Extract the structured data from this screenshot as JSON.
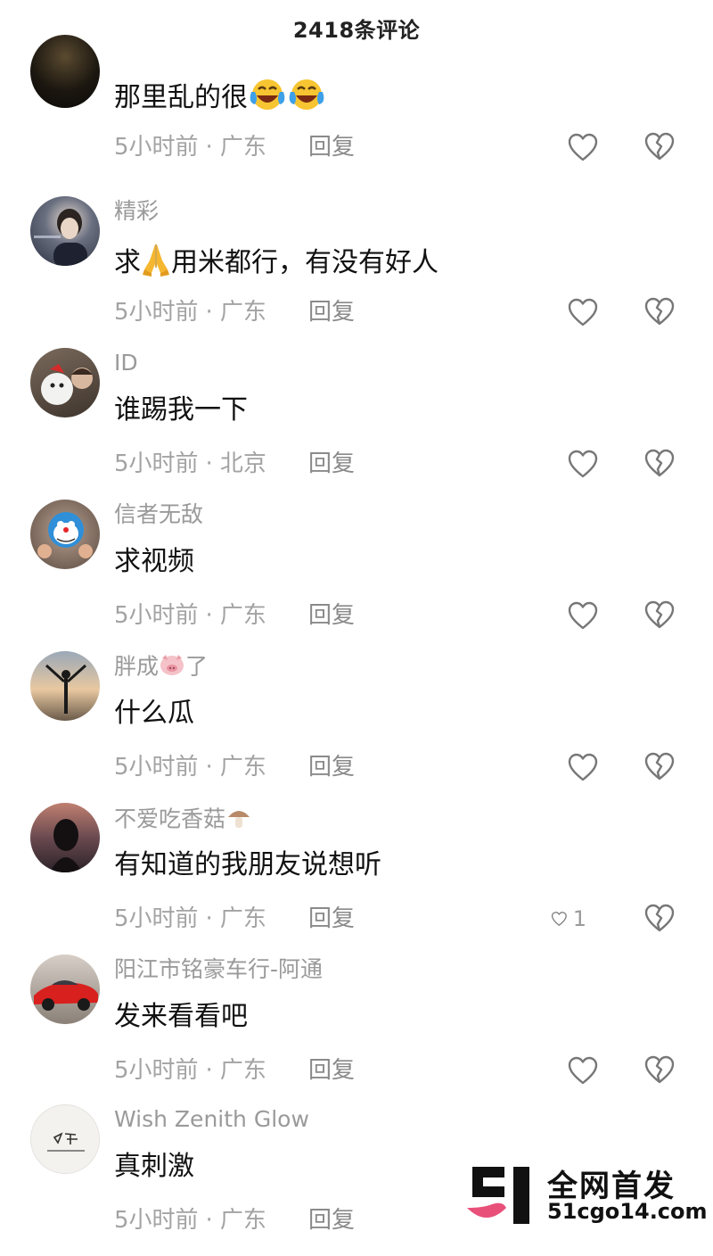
{
  "header": {
    "title": "2418条评论"
  },
  "comments": [
    {
      "username": "",
      "text": "那里乱的很",
      "emoji": "laughing-crying-emoji",
      "time": "5小时前",
      "location": "广东",
      "reply": "回复",
      "likes": ""
    },
    {
      "username": "精彩",
      "text_before": "求",
      "emoji": "praying-hands-emoji",
      "text_after": "用米都行，有没有好人",
      "time": "5小时前",
      "location": "广东",
      "reply": "回复",
      "likes": ""
    },
    {
      "username": "ID",
      "text": "谁踢我一下",
      "time": "5小时前",
      "location": "北京",
      "reply": "回复",
      "likes": ""
    },
    {
      "username": "信者无敌",
      "text": "求视频",
      "time": "5小时前",
      "location": "广东",
      "reply": "回复",
      "likes": ""
    },
    {
      "username_before": "胖成",
      "username_emoji": "pig-face-emoji",
      "username_after": "了",
      "text": "什么瓜",
      "time": "5小时前",
      "location": "广东",
      "reply": "回复",
      "likes": ""
    },
    {
      "username": "不爱吃香菇",
      "username_emoji": "mushroom-emoji",
      "text": "有知道的我朋友说想听",
      "time": "5小时前",
      "location": "广东",
      "reply": "回复",
      "likes": "1"
    },
    {
      "username": "阳江市铭豪车行-阿通",
      "text": "发来看看吧",
      "time": "5小时前",
      "location": "广东",
      "reply": "回复",
      "likes": ""
    },
    {
      "username": "Wish Zenith Glow",
      "text": "真刺激",
      "time": "5小时前",
      "location": "广东",
      "reply": "回复",
      "likes": ""
    }
  ],
  "watermark": {
    "line1": "全网首发",
    "line2": "51cgo14.com"
  },
  "colors": {
    "username": "#9a9a9a",
    "meta": "#a3a3a3",
    "text": "#111111",
    "watermark_pink": "#e8507a"
  }
}
